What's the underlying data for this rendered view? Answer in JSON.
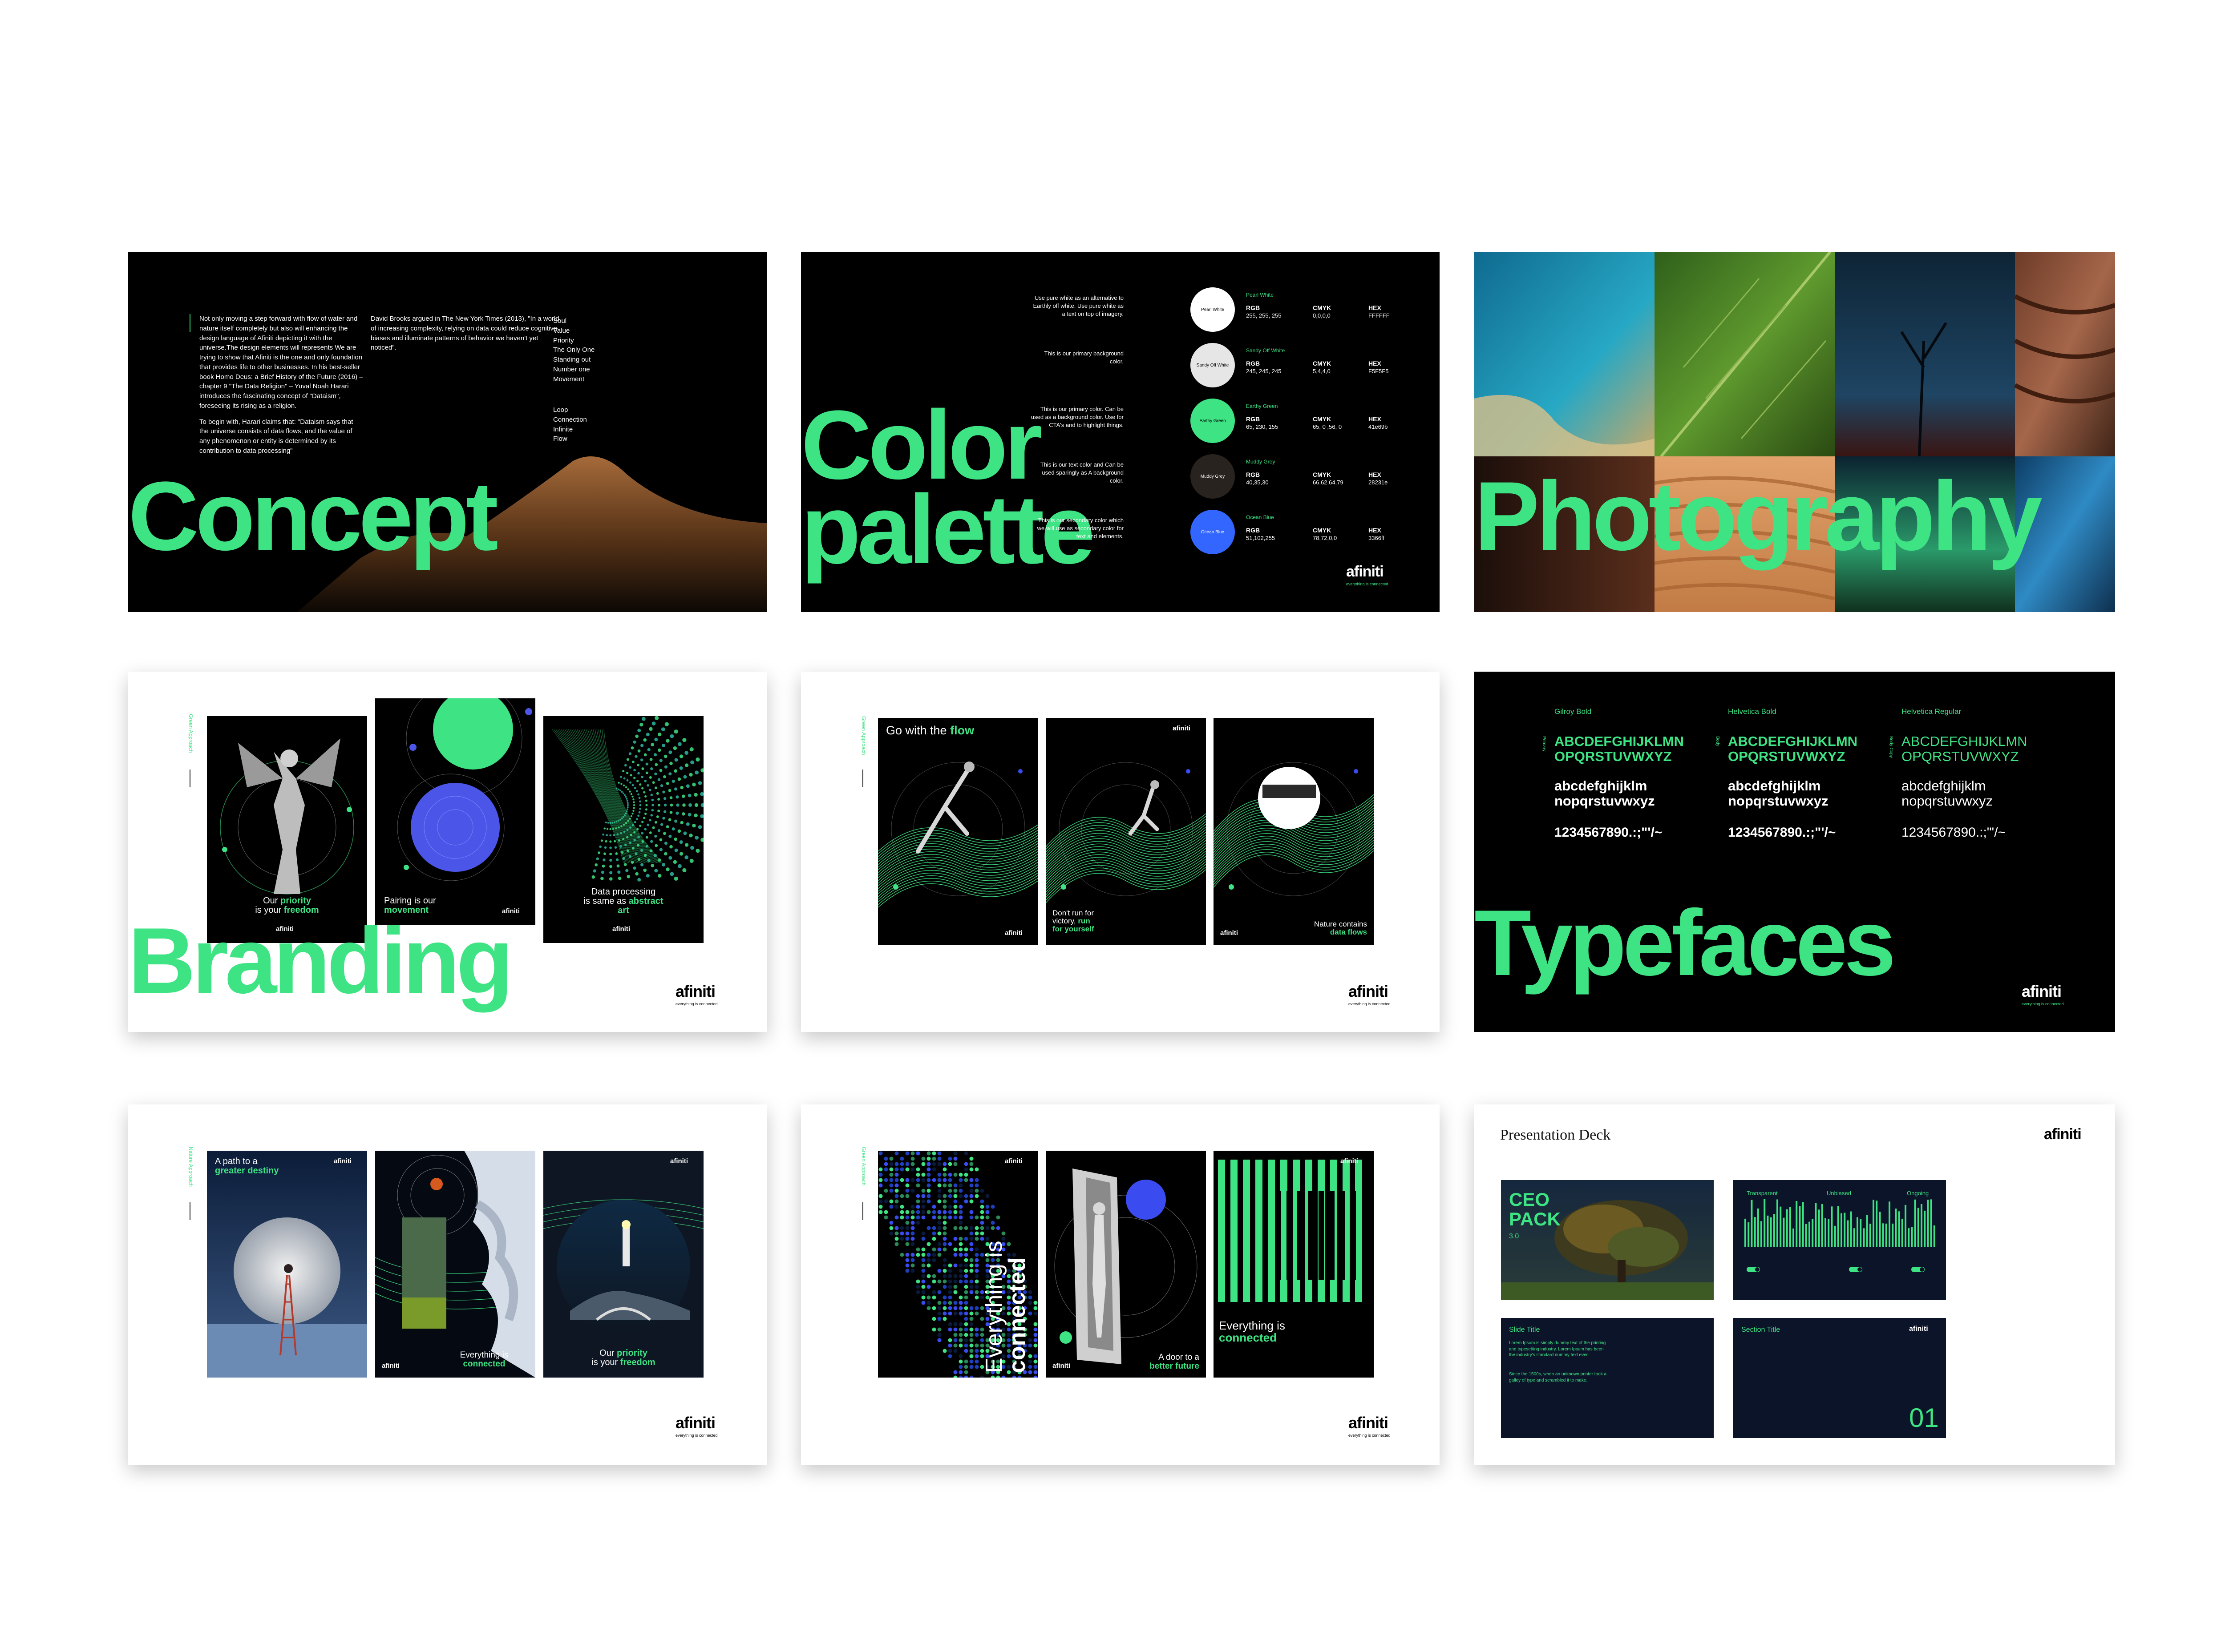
{
  "concept": {
    "title": "Concept",
    "col1_p1": "Not only moving a step forward with flow of water and nature itself completely but also will enhancing the design language of Afiniti depicting it with the universe.The design elements will represents We are trying to show that Afiniti is the one and only foundation that provides life to other businesses. In his best-seller book Homo Deus: a Brief History of the Future (2016) – chapter 9 \"The Data Religion\" – Yuval Noah Harari introduces the fascinating concept of \"Dataism\", foreseeing its rising as a religion.",
    "col1_p2": "To begin with, Harari claims that: \"Dataism says that the universe consists of data flows, and the value of any phenomenon or entity is determined by its contribution to data processing\"",
    "col2_p1": "David Brooks argued in The New York Times (2013), \"In a world of increasing complexity, relying on data could reduce cognitive biases and illuminate patterns of behavior we haven't yet noticed\".",
    "list1": [
      "Soul",
      "Value",
      "Priority",
      "The Only One",
      "Standing out",
      "Number one",
      "Movement"
    ],
    "list2": [
      "Loop",
      "Connection",
      "Infinite",
      "Flow"
    ]
  },
  "palette": {
    "title_line1": "Color",
    "title_line2": "palette",
    "rows": [
      {
        "desc": "Use pure white as an alternative to Earthly off white. Use pure white as a text on top of imagery.",
        "swatch_name": "Pearl White",
        "label": "Pearl White",
        "rgb": "255, 255, 255",
        "cmyk": "0,0,0,0",
        "hex": "FFFFFF",
        "color": "#ffffff",
        "text_color": "#000000"
      },
      {
        "desc": "This is our primary background color.",
        "swatch_name": "Sandy Off White",
        "label": "Sandy Off White",
        "rgb": "245, 245, 245",
        "cmyk": "5,4,4,0",
        "hex": "F5F5F5",
        "color": "#e6e6e6",
        "text_color": "#000000"
      },
      {
        "desc": "This is our primary color. Can be used as a background color. Use for CTA's and to highlight things.",
        "swatch_name": "Earthy Green",
        "label": "Earthy Green",
        "rgb": "65, 230, 155",
        "cmyk": "65, 0 ,56, 0",
        "hex": "41e69b",
        "color": "#3ee383",
        "text_color": "#000000"
      },
      {
        "desc": "This is our text color and Can be used sparingly as A background color.",
        "swatch_name": "Muddy Grey",
        "label": "Muddy Grey",
        "rgb": "40,35,30",
        "cmyk": "66,62,64,79",
        "hex": "28231e",
        "color": "#28231e",
        "text_color": "#ffffff"
      },
      {
        "desc": "This is our secondary color which we will use as secondary color for text and elements.",
        "swatch_name": "Ocean Blue",
        "label": "Ocean Blue",
        "rgb": "51,102,255",
        "cmyk": "78,72,0,0",
        "hex": "3366ff",
        "color": "#3366ff",
        "text_color": "#ffffff"
      }
    ],
    "rgb_key": "RGB",
    "cmyk_key": "CMYK",
    "hex_key": "HEX"
  },
  "photography": {
    "title": "Photography"
  },
  "branding": {
    "title": "Branding",
    "vertical_label": "Green Approach",
    "poster1": {
      "text": "Our ",
      "bold": "priority",
      "line2": "is your ",
      "bold2": "freedom"
    },
    "poster2": {
      "text": "Pairing is our",
      "bold": "movement"
    },
    "poster3": {
      "text": "Data processing",
      "line2": "is same as ",
      "bold2": "abstract",
      "line3": "art"
    }
  },
  "flow": {
    "vertical_label": "Green Approach",
    "poster1": {
      "text": "Go with the ",
      "bold": "flow"
    },
    "poster2": {
      "text": "Don't run for",
      "line2": "victory, ",
      "bold2": "run",
      "line3": "for yourself"
    },
    "poster3": {
      "text": "Nature contains",
      "bold": "data flows"
    }
  },
  "typefaces": {
    "title": "Typefaces",
    "fonts": [
      {
        "name": "Gilroy Bold",
        "upper": "ABCDEFGHIJKLMN OPQRSTUVWXYZ",
        "lower": "abcdefghijklm nopqrstuvwxyz",
        "digits": "1234567890.:;\"'/~",
        "label": "Primary"
      },
      {
        "name": "Helvetica Bold",
        "upper": "ABCDEFGHIJKLMN OPQRSTUVWXYZ",
        "lower": "abcdefghijklm nopqrstuvwxyz",
        "digits": "1234567890.:;\"'/~",
        "label": "Body"
      },
      {
        "name": "Helvetica Regular",
        "upper": "ABCDEFGHIJKLMN OPQRSTUVWXYZ",
        "lower": "abcdefghijklm nopqrstuvwxyz",
        "digits": "1234567890.:;\"'/~",
        "label": "Body Copy"
      }
    ]
  },
  "nature": {
    "vertical_label": "Nature Approach",
    "poster1": {
      "text": "A path to a",
      "bold": "greater destiny"
    },
    "poster2": {
      "text": "Everything is",
      "bold": "connected"
    },
    "poster3": {
      "text": "Our ",
      "bold": "priority",
      "line2": "is your ",
      "bold2": "freedom"
    }
  },
  "digital": {
    "vertical_label": "Green Approach",
    "poster1": {
      "line1": "Everything is",
      "line2": "connected"
    },
    "poster2": {
      "text": "A door to a",
      "bold": "better future"
    },
    "poster3": {
      "text": "Everything is",
      "bold": "connected"
    }
  },
  "deck": {
    "title": "Presentation Deck",
    "card1": {
      "line1": "CEO",
      "line2": "PACK",
      "version": "3.0"
    },
    "card2": {
      "labels": [
        "Transparent",
        "Unbiased",
        "Ongoing"
      ]
    },
    "card3": {
      "title": "Slide Title",
      "body1": "Lorem Ipsum is simply dummy text of the printing and typesetting industry. Lorem Ipsum has been the industry's standard dummy text ever.",
      "body2": "Since the 1500s, when an unknown printer took a galley of type and scrambled it to make."
    },
    "card4": {
      "title": "Section Title",
      "number": "01"
    }
  },
  "brand": {
    "logo": "afiniti",
    "tagline": "everything is connected",
    "accent": "#3ee383",
    "blue": "#3366ff",
    "navy": "#0b1428"
  }
}
